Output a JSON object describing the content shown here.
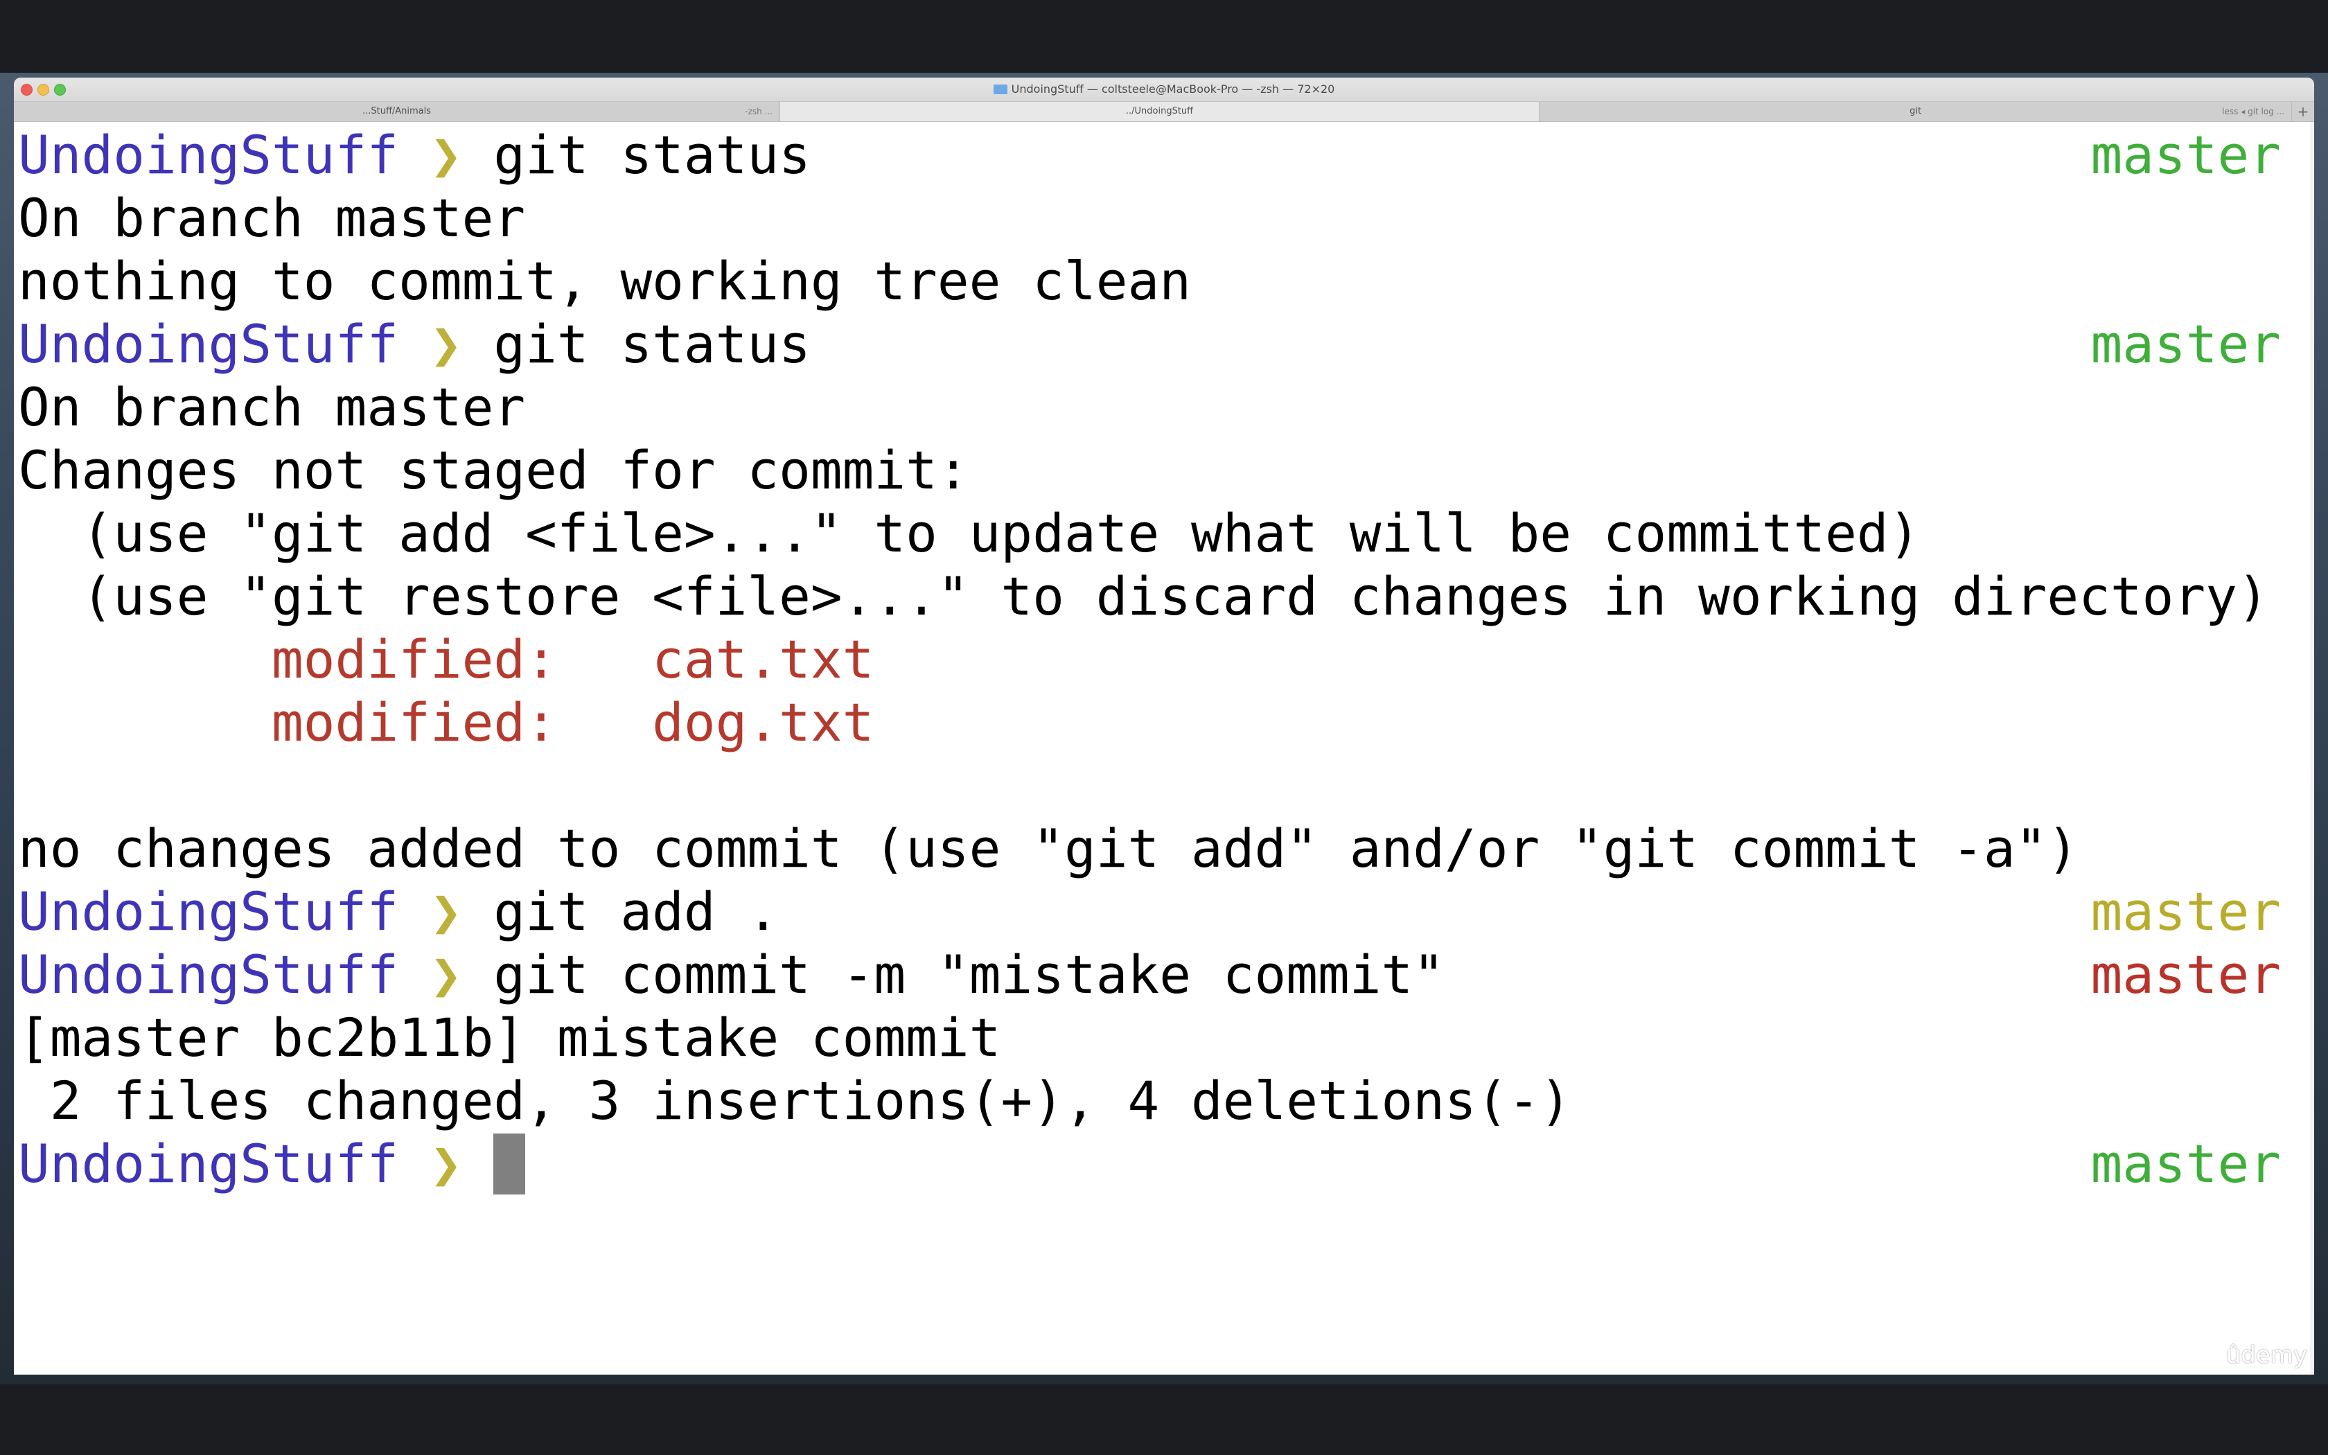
{
  "window": {
    "title": "UndoingStuff — coltsteele@MacBook-Pro — -zsh — 72×20",
    "tabs": [
      {
        "label": "...Stuff/Animals",
        "sub": "-zsh ...",
        "active": false
      },
      {
        "label": "../UndoingStuff",
        "sub": "",
        "active": true
      },
      {
        "label": "git",
        "sub": "",
        "active": false
      },
      {
        "label": "",
        "sub": "less ◂ git log ...",
        "active": false
      }
    ],
    "new_tab": "+"
  },
  "terminal": {
    "lines": [
      {
        "dir": "UndoingStuff",
        "arrow": " ❯ ",
        "cmd": "git status",
        "branch": "master",
        "branch_color": "#3fae3a"
      },
      {
        "text": "On branch master"
      },
      {
        "text": "nothing to commit, working tree clean"
      },
      {
        "dir": "UndoingStuff",
        "arrow": " ❯ ",
        "cmd": "git status",
        "branch": "master",
        "branch_color": "#3fae3a"
      },
      {
        "text": "On branch master"
      },
      {
        "text": "Changes not staged for commit:"
      },
      {
        "text": "  (use \"git add <file>...\" to update what will be committed)"
      },
      {
        "text": "  (use \"git restore <file>...\" to discard changes in working directory)"
      },
      {
        "mod_label": "        modified:   ",
        "mod_file": "cat.txt"
      },
      {
        "mod_label": "        modified:   ",
        "mod_file": "dog.txt"
      },
      {
        "text": ""
      },
      {
        "text": "no changes added to commit (use \"git add\" and/or \"git commit -a\")"
      },
      {
        "dir": "UndoingStuff",
        "arrow": " ❯ ",
        "cmd": "git add .",
        "branch": "master",
        "branch_color": "#b9ac2c"
      },
      {
        "dir": "UndoingStuff",
        "arrow": " ❯ ",
        "cmd": "git commit -m \"mistake commit\"",
        "branch": "master",
        "branch_color": "#b8332a"
      },
      {
        "text": "[master bc2b11b] mistake commit"
      },
      {
        "text": " 2 files changed, 3 insertions(+), 4 deletions(-)"
      },
      {
        "dir": "UndoingStuff",
        "arrow": " ❯ ",
        "cmd": "",
        "branch": "master",
        "branch_color": "#3fae3a",
        "cursor": true
      }
    ]
  },
  "watermark": "ûdemy",
  "colors": {
    "prompt_dir": "#3f34b8",
    "prompt_arrow": "#bdb13a",
    "modified": "#b43a2d"
  }
}
